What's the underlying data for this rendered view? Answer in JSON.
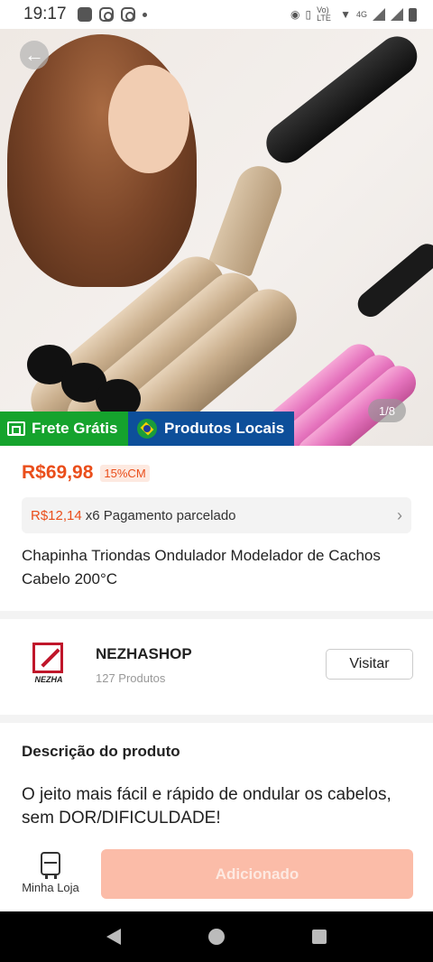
{
  "status_bar": {
    "time": "19:17",
    "network_label": "Vo) LTE",
    "signal_label": "4G"
  },
  "gallery": {
    "page_indicator": "1/8"
  },
  "badges": {
    "shipping": "Frete Grátis",
    "local": "Produtos Locais"
  },
  "price": {
    "current": "R$69,98",
    "discount": "15%CM"
  },
  "installment": {
    "amount": "R$12,14",
    "text": "x6 Pagamento parcelado"
  },
  "product": {
    "title": "Chapinha Triondas Ondulador Modelador de Cachos Cabelo 200°C"
  },
  "shop": {
    "logo_text": "NEZHA",
    "name": "NEZHASHOP",
    "products_count": "127 Produtos",
    "visit_label": "Visitar"
  },
  "description": {
    "title": "Descrição do produto",
    "text": "O jeito mais fácil e rápido de ondular os cabelos, sem DOR/DIFICULDADE!"
  },
  "bottom_bar": {
    "store_label": "Minha Loja",
    "add_label": "Adicionado"
  },
  "icons": {
    "back": "arrow-left-icon",
    "truck": "truck-icon",
    "flag": "brazil-flag-icon",
    "chevron": "chevron-right-icon",
    "store": "store-icon"
  },
  "colors": {
    "price": "#ea4e1b",
    "frete_green": "#15a32d",
    "locais_blue": "#0d4f9a",
    "add_button": "#fbbca8"
  }
}
